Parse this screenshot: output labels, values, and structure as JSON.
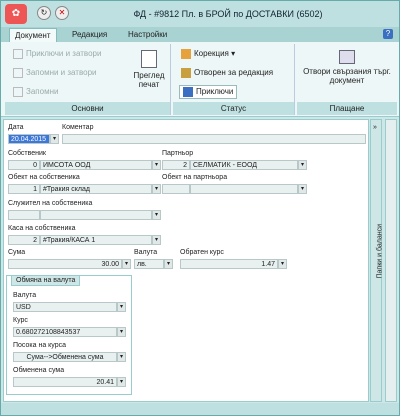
{
  "title": "ФД - #9812 Пл. в БРОЙ по ДОСТАВКИ (6502)",
  "tabs": [
    "Документ",
    "Редакция",
    "Настройки"
  ],
  "help_label": "?",
  "ribbon": {
    "groups": [
      "Основни",
      "Статус",
      "Плащане"
    ],
    "osnovni": [
      "Приключи и затвори",
      "Запомни и затвори",
      "Запомни"
    ],
    "preview": "Преглед печат",
    "status_items": [
      "Корекция",
      "Отворен за редакция",
      "Приключи"
    ],
    "payment": "Отвори свързания търг. документ"
  },
  "form": {
    "date_label": "Дата",
    "date_value": "20.04.2015",
    "comment_label": "Коментар",
    "owner_label": "Собственик",
    "owner_num": "0",
    "owner_value": "ИМСОТА ООД",
    "partner_label": "Партньор",
    "partner_num": "2",
    "partner_value": "СЕЛМАТИК - ЕООД",
    "owner_obj_label": "Обект на собственика",
    "owner_obj_num": "1",
    "owner_obj_value": "#Тракия склад",
    "partner_obj_label": "Обект на партньора",
    "employee_label": "Служител на собственика",
    "cash_label": "Каса на собственика",
    "cash_num": "2",
    "cash_value": "#Тракия/КАСА 1",
    "amount_label": "Сума",
    "amount_value": "30.00",
    "currency_label": "Валута",
    "currency_value": "лв.",
    "reverse_label": "Обратен курс",
    "reverse_value": "1.47",
    "exchange_title": "Обмяна на валута",
    "ex_currency_label": "Валута",
    "ex_currency_value": "USD",
    "rate_label": "Курс",
    "rate_value": "0.680272108843537",
    "direction_label": "Посока на курса",
    "direction_value": "Сума-->Обменена сума",
    "exchanged_label": "Обменена сума",
    "exchanged_value": "20.41"
  },
  "side_label": "Папки и баланси"
}
